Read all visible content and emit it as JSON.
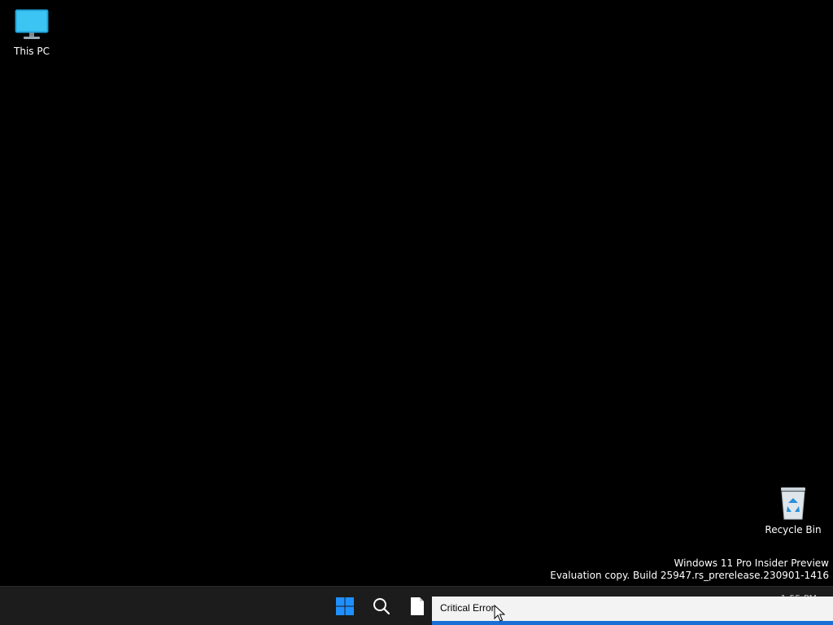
{
  "desktop": {
    "background": "#000000",
    "icons": [
      {
        "label": "This PC",
        "icon": "monitor-icon"
      },
      {
        "label": "Recycle Bin",
        "icon": "recycle-bin-icon"
      }
    ]
  },
  "watermark": {
    "line1": "Windows 11 Pro Insider Preview",
    "line2": "Evaluation copy. Build 25947.rs_prerelease.230901-1416"
  },
  "taskbar": {
    "background": "#1c1c1c",
    "buttons": [
      {
        "name": "start",
        "icon": "windows-logo-icon",
        "accent": "#1e90ff"
      },
      {
        "name": "search",
        "icon": "search-icon"
      },
      {
        "name": "file",
        "icon": "document-icon"
      }
    ],
    "clock_partial": "1:55 PM"
  },
  "tooltip": {
    "text": "Critical Error",
    "accent": "#1a6fd4"
  }
}
